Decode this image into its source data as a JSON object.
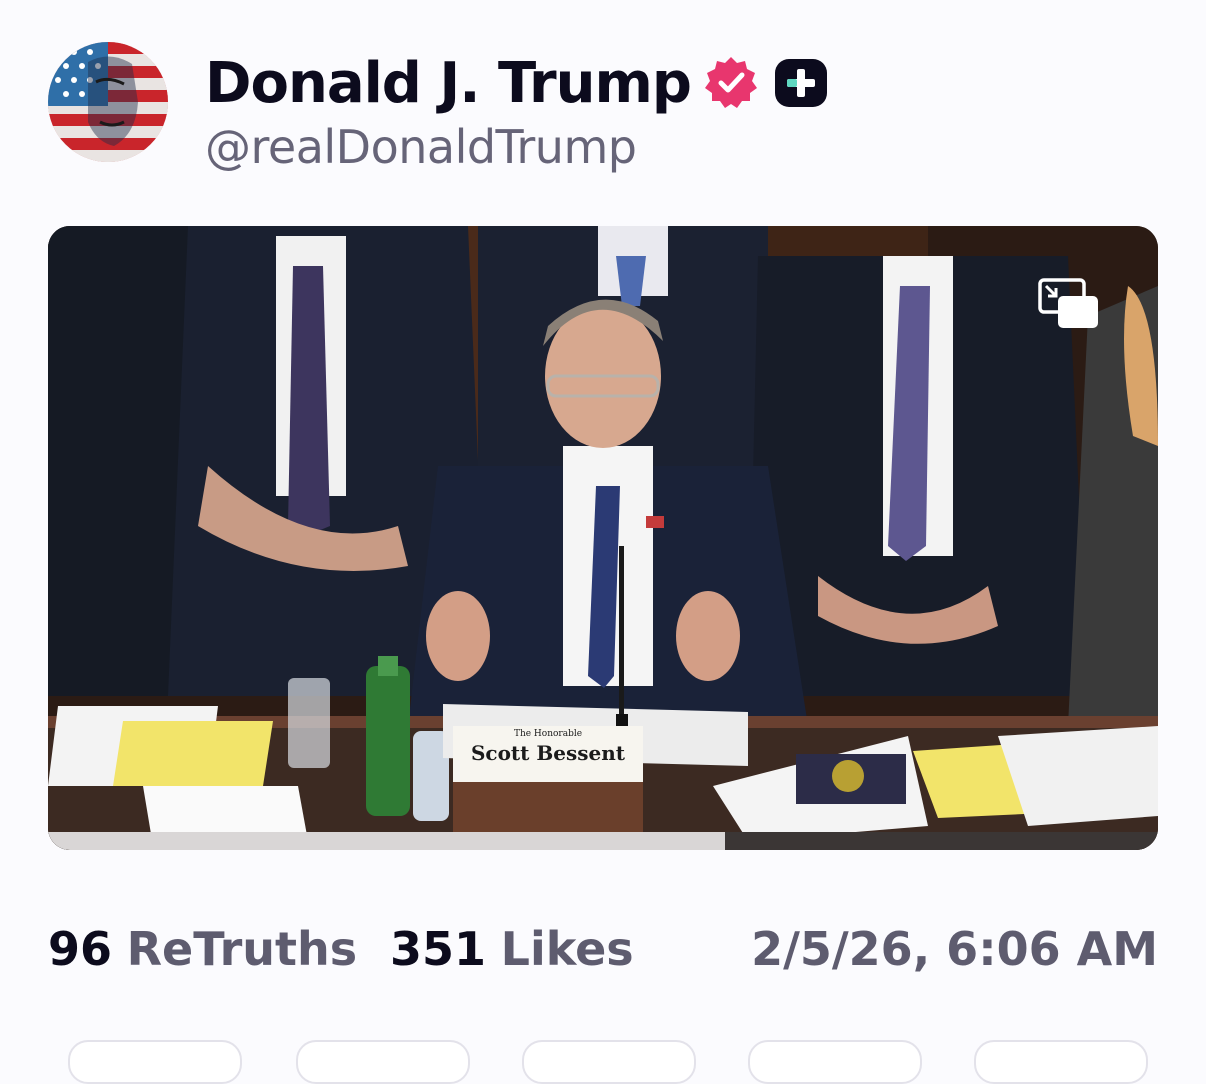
{
  "profile": {
    "display_name": "Donald J. Trump",
    "handle": "@realDonaldTrump",
    "avatar_icon": "avatar-flag-portrait",
    "verified_icon": "verified-badge-icon",
    "verified_color": "#e8366e",
    "plus_icon": "plus-badge-icon"
  },
  "video": {
    "nameplate_title": "The Honorable",
    "nameplate_name": "Scott Bessent",
    "pip_icon": "picture-in-picture-icon",
    "progress_fraction": 0.61
  },
  "stats": {
    "retruths_count": "96",
    "retruths_label": "ReTruths",
    "likes_count": "351",
    "likes_label": "Likes",
    "timestamp": "2/5/26, 6:06 AM"
  },
  "colors": {
    "text_primary": "#0c0b1d",
    "text_secondary": "#5e5c6f",
    "background": "#fbfbfe"
  }
}
